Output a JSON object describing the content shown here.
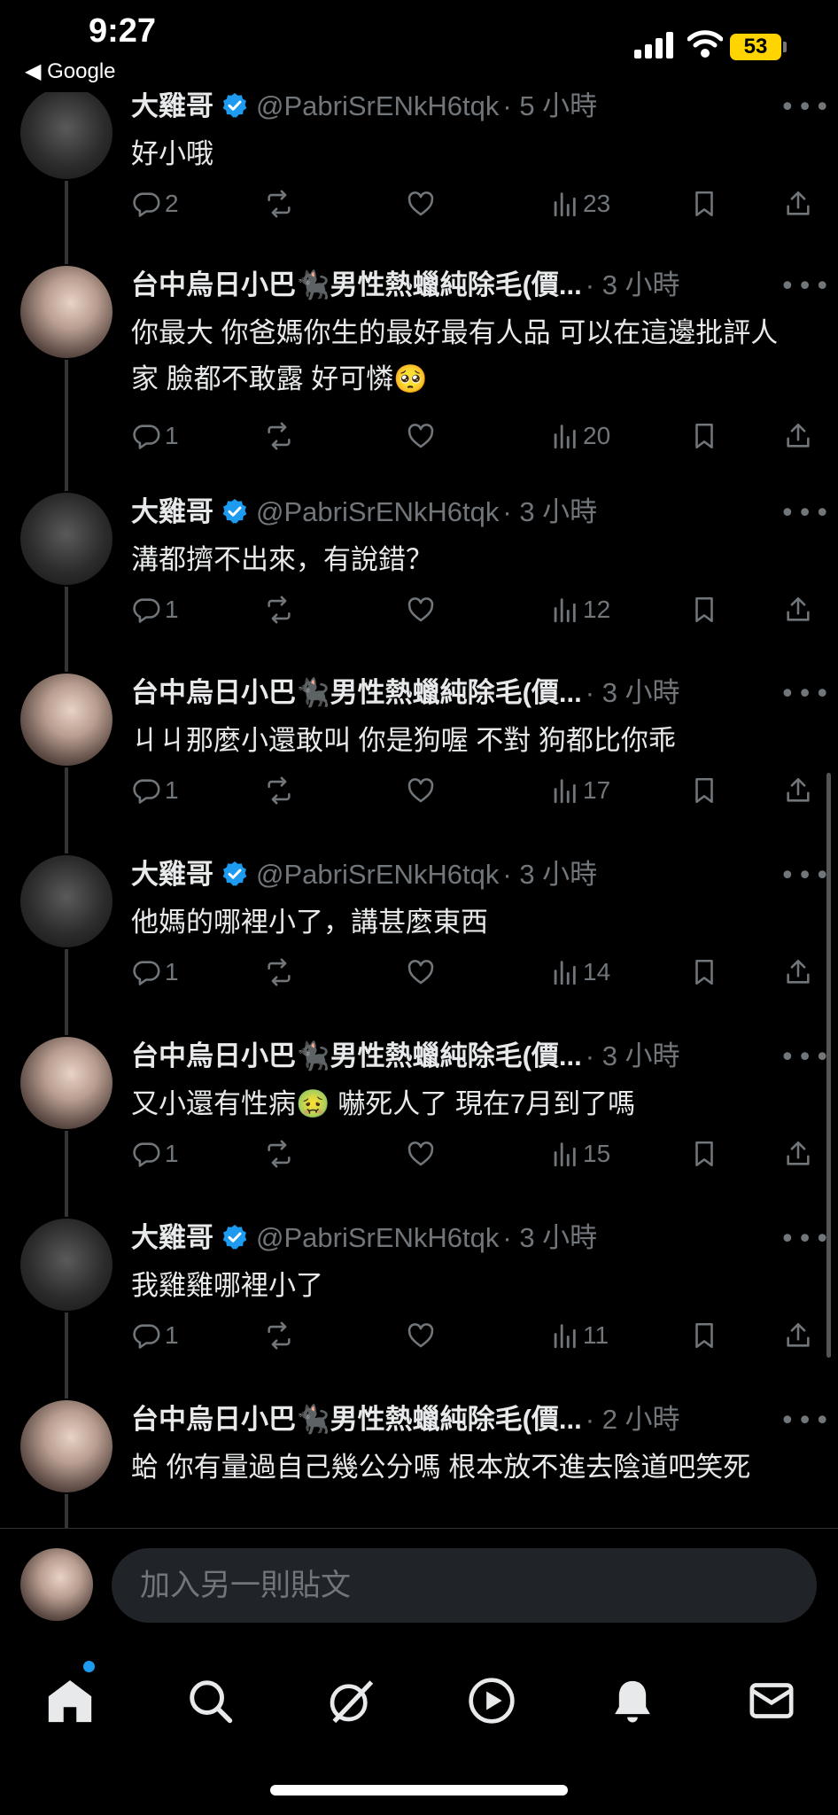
{
  "status_bar": {
    "time": "9:27",
    "back_label": "◀ Google",
    "battery": "53"
  },
  "posts": [
    {
      "author": "大雞哥",
      "verified": true,
      "handle": "@PabriSrENkH6tqk",
      "time": "· 5 小時",
      "text": "好小哦",
      "replies": "2",
      "views": "23",
      "avatar": "scream"
    },
    {
      "author": "台中烏日小巴🐈‍⬛男性熱蠟純除毛(價...",
      "verified": false,
      "handle": "",
      "time": "· 3 小時",
      "text": "你最大 你爸媽你生的最好最有人品 可以在這邊批評人家 臉都不敢露 好可憐🥺",
      "replies": "1",
      "views": "20",
      "avatar": "girl"
    },
    {
      "author": "大雞哥",
      "verified": true,
      "handle": "@PabriSrENkH6tqk",
      "time": "· 3 小時",
      "text": "溝都擠不出來，有說錯？",
      "replies": "1",
      "views": "12",
      "avatar": "scream"
    },
    {
      "author": "台中烏日小巴🐈‍⬛男性熱蠟純除毛(價...",
      "verified": false,
      "handle": "",
      "time": "· 3 小時",
      "text": "ㄐㄐ那麼小還敢叫 你是狗喔 不對 狗都比你乖",
      "replies": "1",
      "views": "17",
      "avatar": "girl"
    },
    {
      "author": "大雞哥",
      "verified": true,
      "handle": "@PabriSrENkH6tqk",
      "time": "· 3 小時",
      "text": "他媽的哪裡小了，講甚麼東西",
      "replies": "1",
      "views": "14",
      "avatar": "scream"
    },
    {
      "author": "台中烏日小巴🐈‍⬛男性熱蠟純除毛(價...",
      "verified": false,
      "handle": "",
      "time": "· 3 小時",
      "text": "又小還有性病🤢 嚇死人了 現在7月到了嗎",
      "replies": "1",
      "views": "15",
      "avatar": "girl"
    },
    {
      "author": "大雞哥",
      "verified": true,
      "handle": "@PabriSrENkH6tqk",
      "time": "· 3 小時",
      "text": "我雞雞哪裡小了",
      "replies": "1",
      "views": "11",
      "avatar": "scream"
    },
    {
      "author": "台中烏日小巴🐈‍⬛男性熱蠟純除毛(價...",
      "verified": false,
      "handle": "",
      "time": "· 2 小時",
      "text": "蛤 你有量過自己幾公分嗎 根本放不進去陰道吧笑死",
      "replies": "",
      "views": "",
      "avatar": "girl"
    }
  ],
  "composer": {
    "placeholder": "加入另一則貼文"
  },
  "tabs": [
    "home",
    "search",
    "grok",
    "video",
    "notifications",
    "messages"
  ],
  "colors": {
    "accent": "#1d9bf0",
    "muted": "#71767b",
    "text": "#e7e9ea"
  }
}
